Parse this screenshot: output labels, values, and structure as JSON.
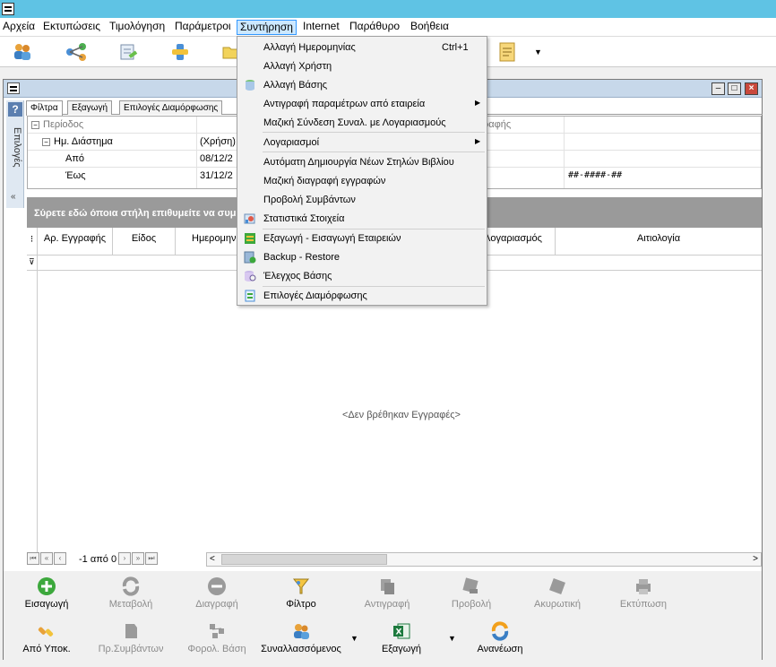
{
  "menubar": {
    "items": [
      "Αρχεία",
      "Εκτυπώσεις",
      "Τιμολόγηση",
      "Παράμετροι",
      "Συντήρηση",
      "Internet",
      "Παράθυρο",
      "Βοήθεια"
    ],
    "open": "Συντήρηση"
  },
  "toolbar": {
    "icons": [
      "users-icon",
      "connections-icon",
      "document-edit-icon",
      "plugin-icon",
      "folder-icon",
      "checklist-icon"
    ]
  },
  "sidepanel": {
    "label": "Επιλογές",
    "help": "?",
    "collapse": "«"
  },
  "tabs": [
    "Φίλτρα",
    "Εξαγωγή",
    "Επιλογές Διαμόρφωσης"
  ],
  "filters": {
    "category": "Περίοδος",
    "range_label": "Ημ. Διάστημα",
    "range_value": "(Χρήση)",
    "from_label": "Από",
    "from_value": "08/12/2",
    "to_label": "Έως",
    "to_value": "31/12/2",
    "right_header_fragment": "ραφής",
    "mask_value": "##-####-##"
  },
  "grid": {
    "group_hint": "Σύρετε εδώ όποια στήλη επιθυμείτε να συμ",
    "columns": [
      "Αρ. Εγγραφής",
      "Είδος",
      "Ημερομηνί",
      "Λογαριασμός",
      "Αιτιολογία"
    ],
    "empty_text": "<Δεν βρέθηκαν Εγγραφές>",
    "nav_text": "-1 από 0"
  },
  "actions": {
    "row1": [
      {
        "label": "Εισαγωγή",
        "enabled": true
      },
      {
        "label": "Μεταβολή",
        "enabled": false
      },
      {
        "label": "Διαγραφή",
        "enabled": false
      },
      {
        "label": "Φίλτρο",
        "enabled": true
      },
      {
        "label": "Αντιγραφή",
        "enabled": false
      },
      {
        "label": "Προβολή",
        "enabled": false
      },
      {
        "label": "Ακυρωτική",
        "enabled": false
      },
      {
        "label": "Εκτύπωση",
        "enabled": false
      }
    ],
    "row2": [
      {
        "label": "Από Υποκ.",
        "enabled": true
      },
      {
        "label": "Πρ.Συμβάντων",
        "enabled": false
      },
      {
        "label": "Φορολ. Βάση",
        "enabled": false
      },
      {
        "label": "Συναλλασσόμενος",
        "enabled": true
      },
      {
        "label": "Εξαγωγή",
        "enabled": true
      },
      {
        "label": "Ανανέωση",
        "enabled": true
      }
    ]
  },
  "dropdown": {
    "items": [
      {
        "label": "Αλλαγή Ημερομηνίας",
        "shortcut": "Ctrl+1",
        "icon": "",
        "submenu": false
      },
      {
        "label": "Αλλαγή Χρήστη",
        "shortcut": "",
        "icon": "",
        "submenu": false
      },
      {
        "label": "Αλλαγή Βάσης",
        "shortcut": "",
        "icon": "database-icon",
        "submenu": false
      },
      {
        "label": "Αντιγραφή παραμέτρων από εταιρεία",
        "shortcut": "",
        "icon": "",
        "submenu": true
      },
      {
        "label": "Μαζική Σύνδεση Συναλ. με Λογαριασμούς",
        "shortcut": "",
        "icon": "",
        "submenu": false
      },
      {
        "label": "Λογαριασμοί",
        "shortcut": "",
        "icon": "",
        "submenu": true
      },
      {
        "label": "Αυτόματη Δημιουργία Νέων Στηλών Βιβλίου",
        "shortcut": "",
        "icon": "",
        "submenu": false
      },
      {
        "label": "Μαζική διαγραφή εγγραφών",
        "shortcut": "",
        "icon": "",
        "submenu": false
      },
      {
        "label": "Προβολή Συμβάντων",
        "shortcut": "",
        "icon": "",
        "submenu": false
      },
      {
        "label": "Στατιστικά Στοιχεία",
        "shortcut": "",
        "icon": "statistics-icon",
        "submenu": false
      },
      {
        "label": "Εξαγωγή - Εισαγωγή Εταιρειών",
        "shortcut": "",
        "icon": "import-export-icon",
        "submenu": false
      },
      {
        "label": "Backup - Restore",
        "shortcut": "",
        "icon": "backup-icon",
        "submenu": false
      },
      {
        "label": "Έλεγχος Βάσης",
        "shortcut": "",
        "icon": "database-check-icon",
        "submenu": false
      },
      {
        "label": "Επιλογές Διαμόρφωσης",
        "shortcut": "",
        "icon": "options-icon",
        "submenu": false
      }
    ]
  }
}
